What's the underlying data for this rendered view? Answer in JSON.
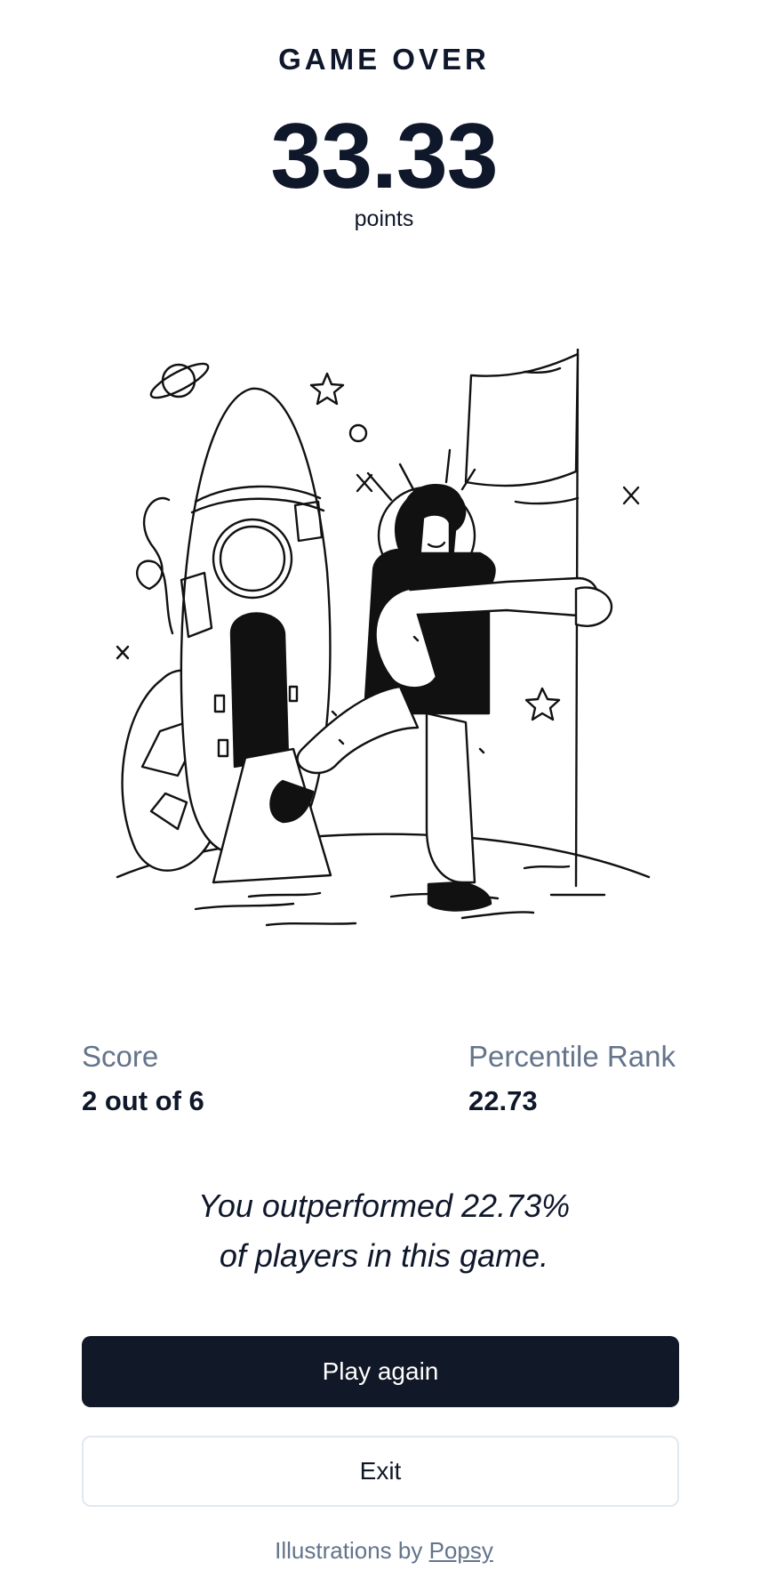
{
  "header": {
    "title": "GAME OVER",
    "score": "33.33",
    "score_unit": "points"
  },
  "illustration": {
    "name": "astronaut-rocket-illustration"
  },
  "stats": {
    "score_label": "Score",
    "score_value": "2 out of 6",
    "rank_label": "Percentile Rank",
    "rank_value": "22.73"
  },
  "summary": {
    "line1": "You outperformed 22.73%",
    "line2": "of players in this game."
  },
  "actions": {
    "play_again_label": "Play again",
    "exit_label": "Exit"
  },
  "credit": {
    "prefix": "Illustrations by",
    "link_text": "Popsy"
  },
  "colors": {
    "primary": "#111827",
    "text": "#0f172a",
    "muted": "#64748b",
    "border": "#e2e8f0"
  }
}
